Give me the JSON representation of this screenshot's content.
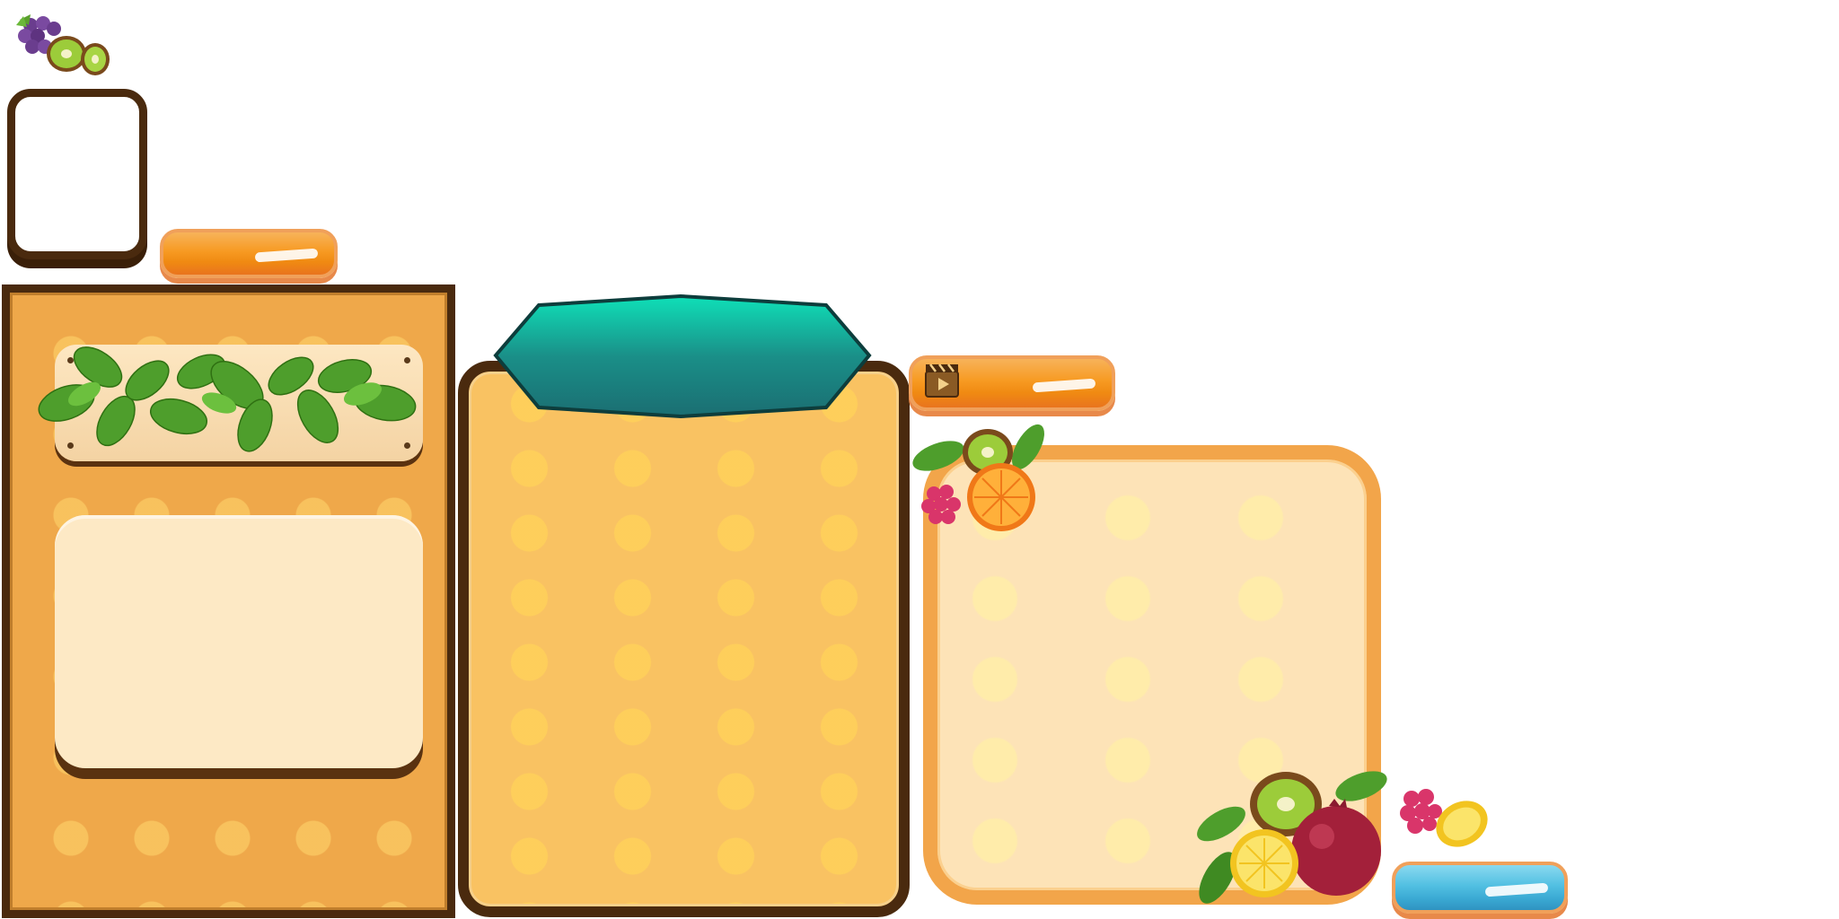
{
  "screen": {
    "title": "",
    "description_elements": []
  },
  "icons": {
    "fruit_cluster_top_left": "grapes-kiwi-icon",
    "leaves_plaque": "leaves-icon",
    "teal_header": "teal-banner-icon",
    "video_clapper": "video-clapper-icon",
    "fruit_cluster_panel_corner": "kiwi-orange-raspberry-icon",
    "fruit_cluster_bottom": "kiwi-lemon-pomegranate-icon",
    "fruit_cluster_small": "raspberry-lemon-icon"
  },
  "colors": {
    "brown_frame": "#4a2a0e",
    "orange_button": "#f79a22",
    "blue_button": "#3aa9d3",
    "teal_banner": "#1b7a7a",
    "panel_orange": "#efa84a",
    "panel_yellow": "#f9c262",
    "panel_light": "#fde3b7",
    "cream": "#fde9c5"
  },
  "buttons": {
    "orange_pill_label": "",
    "video_pill_label": "",
    "blue_pill_label": ""
  }
}
